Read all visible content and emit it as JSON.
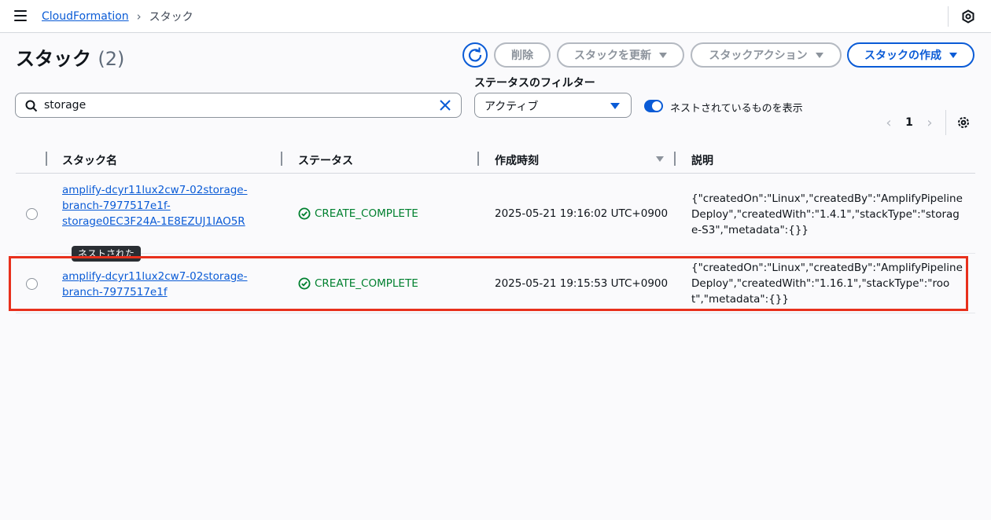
{
  "breadcrumb": {
    "service": "CloudFormation",
    "current": "スタック"
  },
  "page": {
    "title": "スタック",
    "count": "(2)"
  },
  "toolbar": {
    "delete_label": "削除",
    "update_label": "スタックを更新",
    "actions_label": "スタックアクション",
    "create_label": "スタックの作成"
  },
  "filters": {
    "search_value": "storage",
    "status_filter_label": "ステータスのフィルター",
    "status_selected": "アクティブ",
    "nested_toggle_label": "ネストされているものを表示"
  },
  "pagination": {
    "current_page": "1"
  },
  "table": {
    "columns": [
      "スタック名",
      "ステータス",
      "作成時刻",
      "説明"
    ],
    "rows": [
      {
        "name": "amplify-dcyr11lux2cw7-02storage-branch-7977517e1f-storage0EC3F24A-1E8EZUJ1IAO5R",
        "badge": "ネストされた",
        "status": "CREATE_COMPLETE",
        "created": "2025-05-21 19:16:02 UTC+0900",
        "description": "{\"createdOn\":\"Linux\",\"createdBy\":\"AmplifyPipelineDeploy\",\"createdWith\":\"1.4.1\",\"stackType\":\"storage-S3\",\"metadata\":{}}"
      },
      {
        "name": "amplify-dcyr11lux2cw7-02storage-branch-7977517e1f",
        "status": "CREATE_COMPLETE",
        "created": "2025-05-21 19:15:53 UTC+0900",
        "description": "{\"createdOn\":\"Linux\",\"createdBy\":\"AmplifyPipelineDeploy\",\"createdWith\":\"1.16.1\",\"stackType\":\"root\",\"metadata\":{}}"
      }
    ]
  },
  "colors": {
    "accent": "#0a5bd6",
    "success": "#00802f",
    "highlight": "#e8301c"
  }
}
